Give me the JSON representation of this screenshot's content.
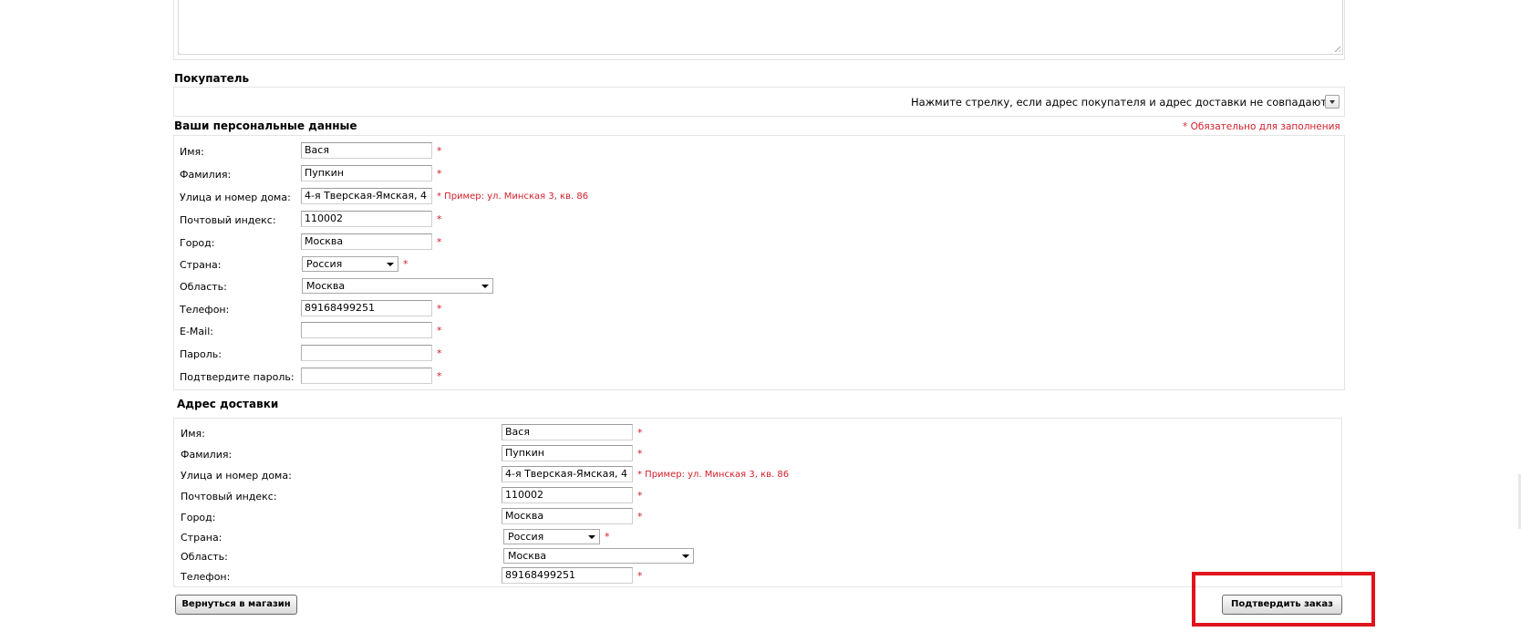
{
  "buyer": {
    "title": "Покупатель",
    "arrow_prompt": "Нажмите стрелку, если адрес покупателя и адрес доставки не совпадают:"
  },
  "personal": {
    "title": "Ваши персональные данные",
    "required_note": "* Обязательно для заполнения",
    "labels": {
      "first_name": "Имя:",
      "last_name": "Фамилия:",
      "street": "Улица и номер дома:",
      "zip": "Почтовый индекс:",
      "city": "Город:",
      "country": "Страна:",
      "region": "Область:",
      "phone": "Телефон:",
      "email": "E-Mail:",
      "password": "Пароль:",
      "password_confirm": "Подтвердите пароль:"
    },
    "values": {
      "first_name": "Вася",
      "last_name": "Пупкин",
      "street": "4-я Тверская-Ямская, 4",
      "zip": "110002",
      "city": "Москва",
      "country": "Россия",
      "region": "Москва",
      "phone": "89168499251",
      "email": "",
      "password": "",
      "password_confirm": ""
    },
    "street_hint": "* Пример: ул. Минская 3, кв. 86"
  },
  "delivery": {
    "title": "Адрес доставки",
    "labels": {
      "first_name": "Имя:",
      "last_name": "Фамилия:",
      "street": "Улица и номер дома:",
      "zip": "Почтовый индекс:",
      "city": "Город:",
      "country": "Страна:",
      "region": "Область:",
      "phone": "Телефон:"
    },
    "values": {
      "first_name": "Вася",
      "last_name": "Пупкин",
      "street": "4-я Тверская-Ямская, 4",
      "zip": "110002",
      "city": "Москва",
      "country": "Россия",
      "region": "Москва",
      "phone": "89168499251"
    },
    "street_hint": "* Пример: ул. Минская 3, кв. 86"
  },
  "required_mark": "*",
  "buttons": {
    "back": "Вернуться в магазин",
    "confirm": "Подтвердить заказ"
  },
  "colors": {
    "required": "#d0202a",
    "highlight": "#e0141c"
  }
}
